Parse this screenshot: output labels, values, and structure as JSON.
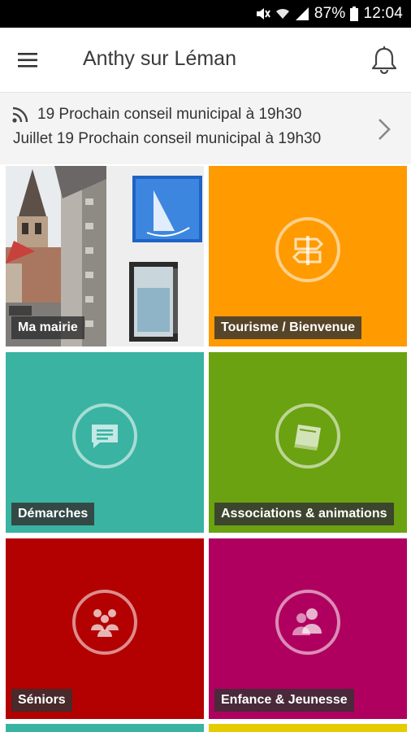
{
  "status_bar": {
    "battery_text": "87%",
    "time": "12:04",
    "icons": [
      "mute-icon",
      "wifi-icon",
      "signal-icon",
      "battery-icon"
    ]
  },
  "app_bar": {
    "title": "Anthy sur Léman",
    "menu_icon": "hamburger-menu-icon",
    "bell_icon": "notification-bell-icon"
  },
  "news": {
    "line1": "19 Prochain conseil municipal à 19h30",
    "line2": "Juillet 19 Prochain conseil municipal à 19h30",
    "icon": "rss-icon"
  },
  "tiles": [
    {
      "label": "Ma mairie",
      "color": "#cfd4d8",
      "icon": "photo-town-hall"
    },
    {
      "label": "Tourisme / Bienvenue",
      "color": "#ff9a00",
      "icon": "signpost-icon"
    },
    {
      "label": "Démarches",
      "color": "#3ab3a3",
      "icon": "message-icon"
    },
    {
      "label": "Associations & animations",
      "color": "#6aa211",
      "icon": "book-icon"
    },
    {
      "label": "Séniors",
      "color": "#b30000",
      "icon": "group-icon"
    },
    {
      "label": "Enfance & Jeunesse",
      "color": "#b0005f",
      "icon": "people-icon"
    }
  ]
}
